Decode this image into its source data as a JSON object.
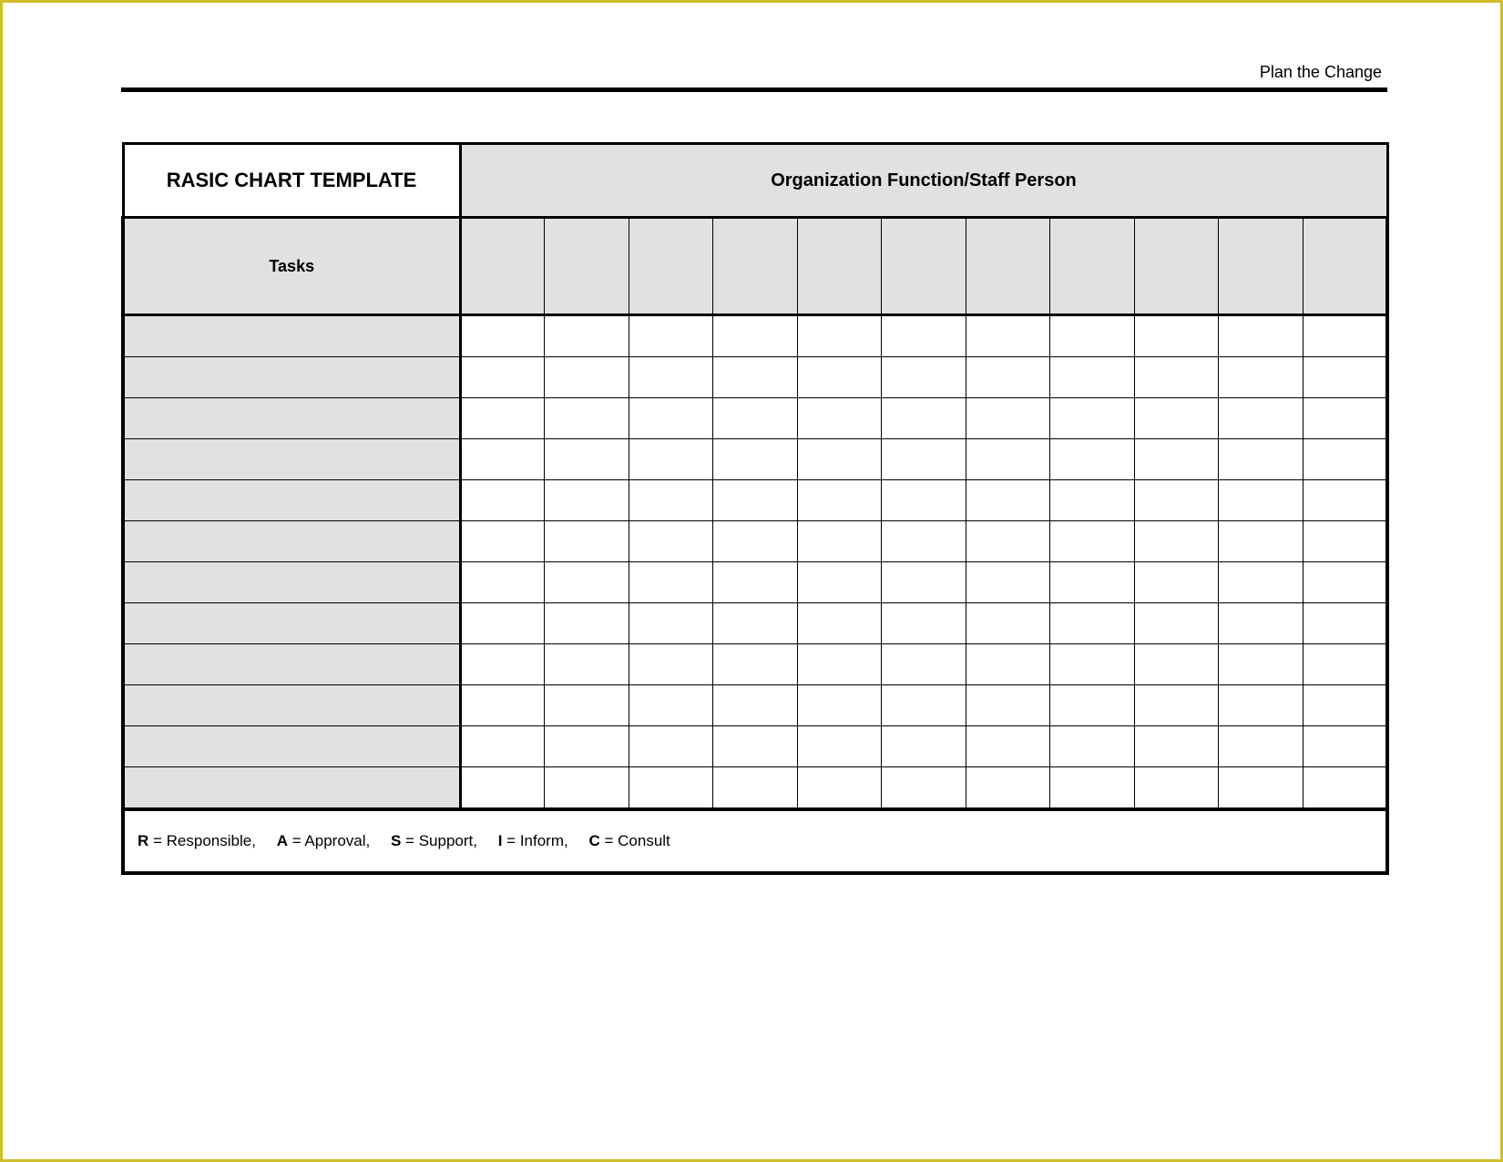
{
  "header": {
    "right_label": "Plan the Change"
  },
  "chart_data": {
    "type": "table",
    "title": "RASIC CHART TEMPLATE",
    "column_group_header": "Organization Function/Staff Person",
    "row_group_header": "Tasks",
    "num_columns": 11,
    "num_task_rows": 12,
    "column_headers": [
      "",
      "",
      "",
      "",
      "",
      "",
      "",
      "",
      "",
      "",
      ""
    ],
    "task_rows": [
      "",
      "",
      "",
      "",
      "",
      "",
      "",
      "",
      "",
      "",
      "",
      ""
    ],
    "grid": [
      [
        "",
        "",
        "",
        "",
        "",
        "",
        "",
        "",
        "",
        "",
        ""
      ],
      [
        "",
        "",
        "",
        "",
        "",
        "",
        "",
        "",
        "",
        "",
        ""
      ],
      [
        "",
        "",
        "",
        "",
        "",
        "",
        "",
        "",
        "",
        "",
        ""
      ],
      [
        "",
        "",
        "",
        "",
        "",
        "",
        "",
        "",
        "",
        "",
        ""
      ],
      [
        "",
        "",
        "",
        "",
        "",
        "",
        "",
        "",
        "",
        "",
        ""
      ],
      [
        "",
        "",
        "",
        "",
        "",
        "",
        "",
        "",
        "",
        "",
        ""
      ],
      [
        "",
        "",
        "",
        "",
        "",
        "",
        "",
        "",
        "",
        "",
        ""
      ],
      [
        "",
        "",
        "",
        "",
        "",
        "",
        "",
        "",
        "",
        "",
        ""
      ],
      [
        "",
        "",
        "",
        "",
        "",
        "",
        "",
        "",
        "",
        "",
        ""
      ],
      [
        "",
        "",
        "",
        "",
        "",
        "",
        "",
        "",
        "",
        "",
        ""
      ],
      [
        "",
        "",
        "",
        "",
        "",
        "",
        "",
        "",
        "",
        "",
        ""
      ],
      [
        "",
        "",
        "",
        "",
        "",
        "",
        "",
        "",
        "",
        "",
        ""
      ]
    ]
  },
  "legend": {
    "items": [
      {
        "code": "R",
        "meaning": "Responsible"
      },
      {
        "code": "A",
        "meaning": "Approval"
      },
      {
        "code": "S",
        "meaning": "Support"
      },
      {
        "code": "I",
        "meaning": "Inform"
      },
      {
        "code": "C",
        "meaning": "Consult"
      }
    ]
  }
}
